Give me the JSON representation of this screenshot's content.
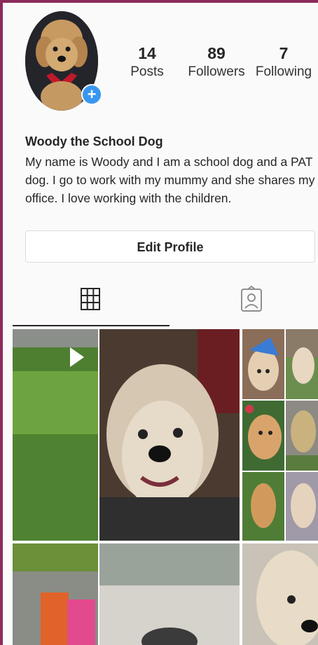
{
  "profile": {
    "posts_count": "14",
    "posts_label": "Posts",
    "followers_count": "89",
    "followers_label": "Followers",
    "following_count": "7",
    "following_label": "Following",
    "name": "Woody the School Dog",
    "bio_lines": [
      "My name is Woody and I am a school dog and a PAT",
      "dog. I go to work with my mummy and she shares my",
      "office. I love working with the children."
    ],
    "edit_button": "Edit Profile",
    "add_story_symbol": "+"
  },
  "tabs": {
    "grid_icon": "grid-icon",
    "tagged_icon": "tagged-person-icon",
    "active": "grid"
  },
  "colors": {
    "frame_border": "#8c2a5a",
    "accent_blue": "#3897f0",
    "text": "#262626"
  },
  "photos": [
    "grass lawn video thumbnail",
    "close-up of cream dog face looking up",
    "dog wearing blue hat",
    "dog sitting in garden",
    "dog on grass with flowers",
    "dog sitting on path",
    "dog sitting on lawn",
    "dog beside flowers",
    "office desk with snack packets",
    "close-up on table with water",
    "close-up of dog face"
  ]
}
